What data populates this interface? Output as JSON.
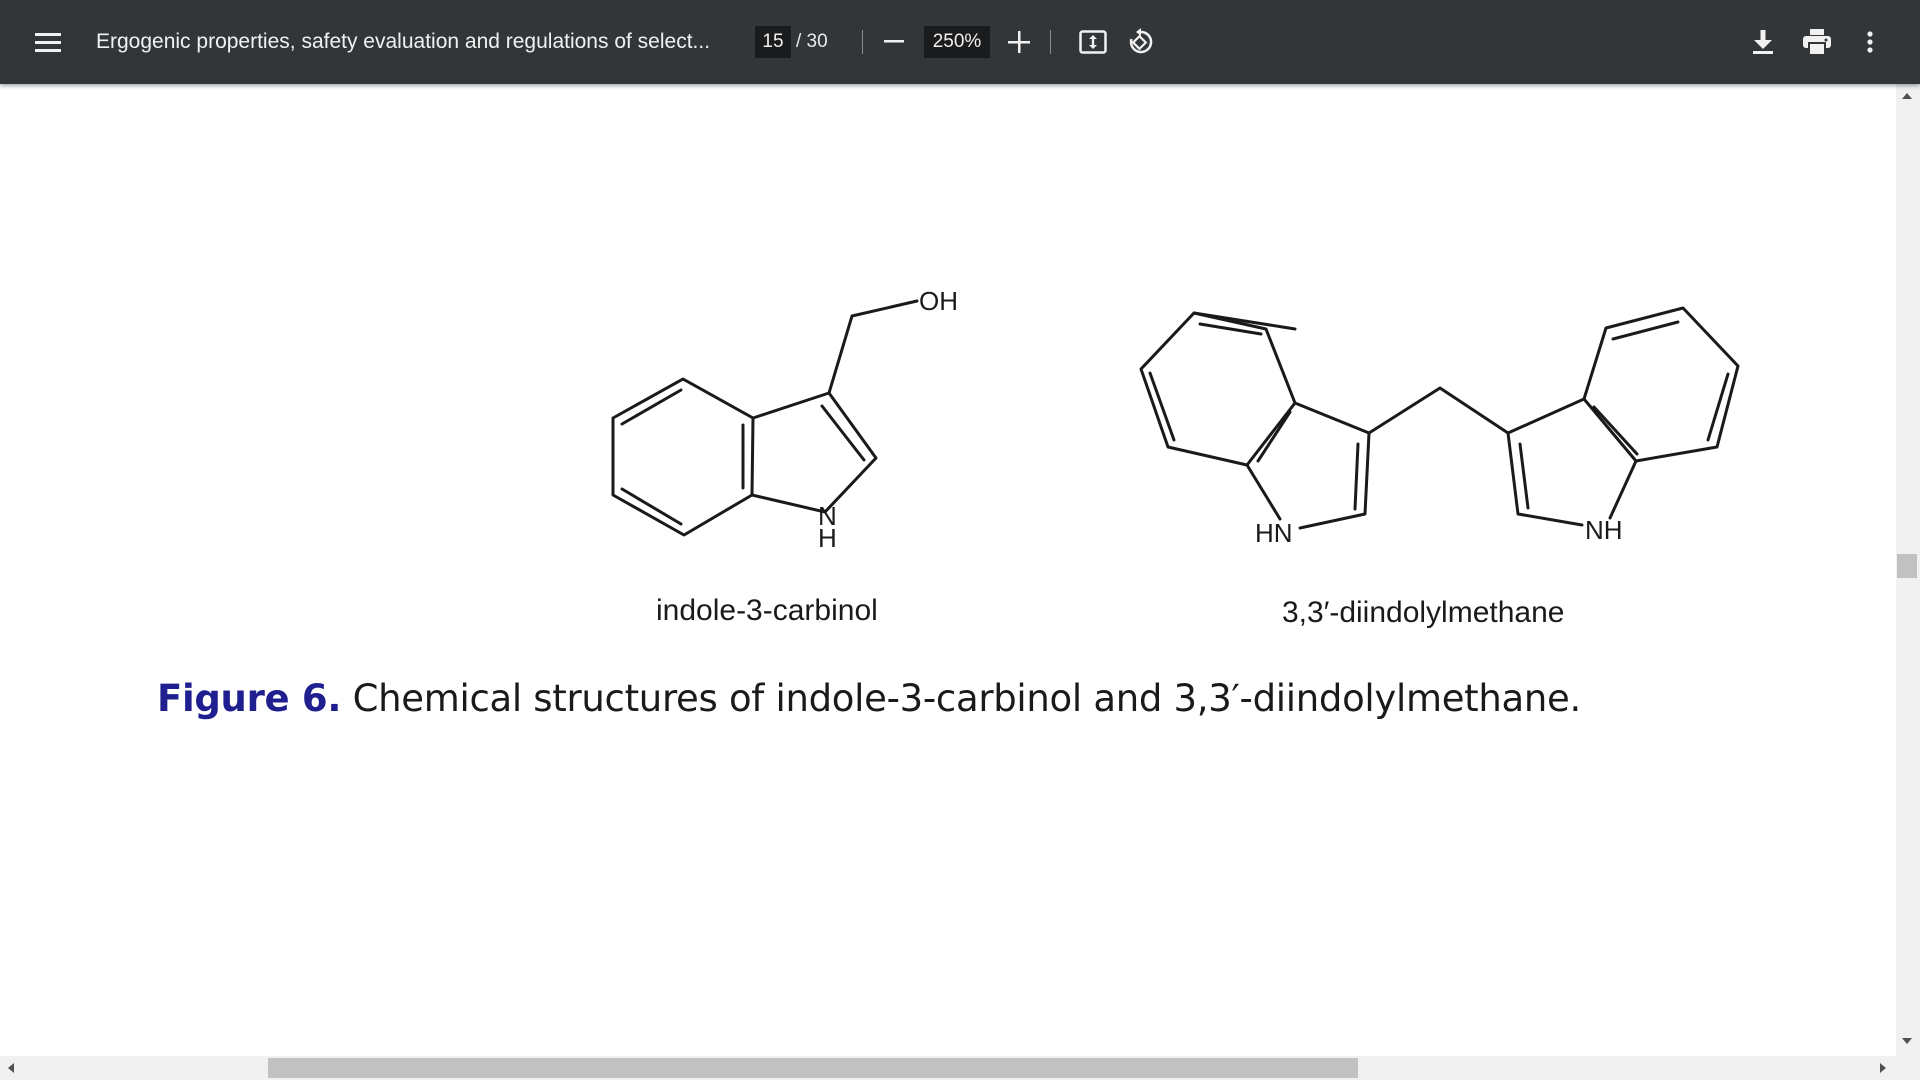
{
  "toolbar": {
    "menu_icon": "menu-icon",
    "title": "Ergogenic properties, safety evaluation and regulations of select...",
    "page_current": "15",
    "page_total": "/ 30",
    "zoom": "250%",
    "icons": [
      "zoom-out-icon",
      "zoom-in-icon",
      "fit-page-icon",
      "rotate-icon",
      "download-icon",
      "print-icon",
      "more-options-icon"
    ]
  },
  "figure": {
    "molecule_1": {
      "name": "indole-3-carbinol",
      "atom_labels": [
        "OH",
        "N",
        "H"
      ]
    },
    "molecule_2": {
      "name": "3,3′-diindolylmethane",
      "atom_labels": [
        "HN",
        "NH"
      ]
    },
    "caption_label": "Figure 6.",
    "caption_text": " Chemical structures of indole-3-carbinol and 3,3′-diindolylmethane."
  },
  "colors": {
    "toolbar_bg": "#323639",
    "caption_label": "#1f1f8f",
    "viewer_bg": "#525659"
  }
}
